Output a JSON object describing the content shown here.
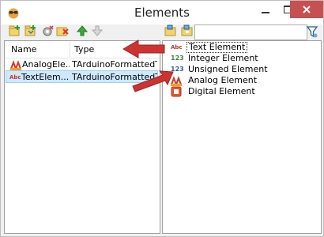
{
  "window": {
    "title": "Elements"
  },
  "colors": {
    "accent": "#cc3333",
    "selection": "#cde8ff",
    "close": "#c75050"
  },
  "toolbar": {
    "buttons": [
      "add-icon",
      "insert-icon",
      "gear-delete-icon",
      "delete-icon",
      "move-up-icon",
      "move-down-icon"
    ],
    "right_buttons": [
      "open-folder-icon",
      "folder-icon"
    ],
    "search": {
      "value": "",
      "placeholder": ""
    }
  },
  "list": {
    "headers": {
      "name": "Name",
      "type": "Type"
    },
    "rows": [
      {
        "name": "AnalogEle...",
        "type": "TArduinoFormattedT...",
        "icon": "analog-element-icon",
        "selected": false
      },
      {
        "name": "TextElem...",
        "type": "TArduinoFormattedT...",
        "icon": "text-element-icon",
        "selected": true
      }
    ]
  },
  "palette": {
    "items": [
      {
        "label": "Text Element",
        "icon": "text-element-icon"
      },
      {
        "label": "Integer Element",
        "icon": "integer-element-icon"
      },
      {
        "label": "Unsigned Element",
        "icon": "unsigned-element-icon"
      },
      {
        "label": "Analog Element",
        "icon": "analog-element-icon"
      },
      {
        "label": "Digital Element",
        "icon": "digital-element-icon"
      }
    ]
  },
  "icon_glyphs": {
    "text": "Abc",
    "integer": "123"
  }
}
